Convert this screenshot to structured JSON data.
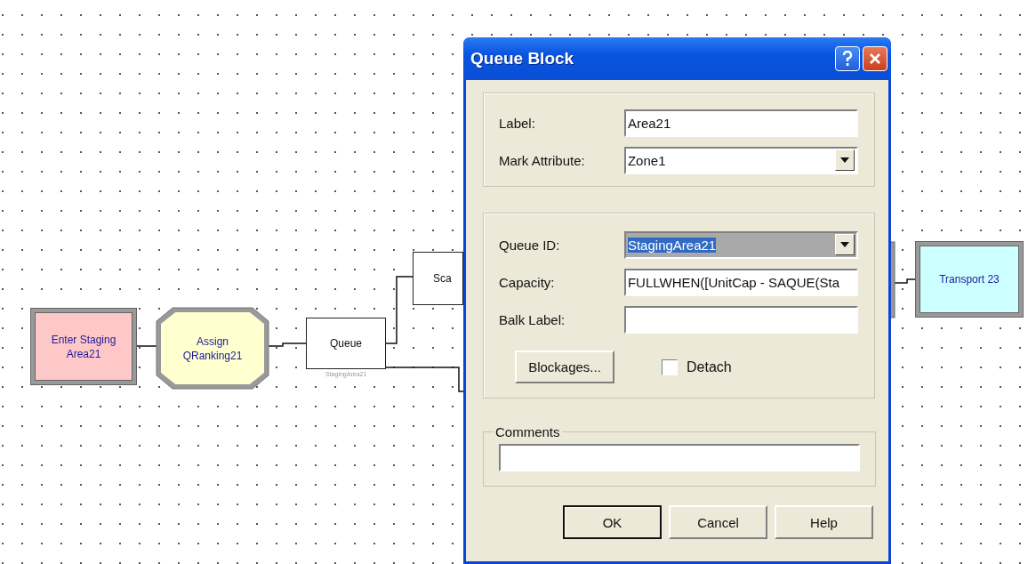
{
  "canvas": {
    "blocks": [
      {
        "kind": "enter",
        "label": "Enter Staging Area21",
        "color": "#ffc8c8"
      },
      {
        "kind": "assign",
        "label": "Assign QRanking21",
        "color": "#ffffd0"
      },
      {
        "kind": "queue",
        "label": "Queue",
        "caption": "StagingArea21",
        "color": "#ffffff"
      },
      {
        "kind": "plain",
        "label": "Sca",
        "color": "#ffffff"
      },
      {
        "kind": "transport",
        "label": "Transport 23",
        "color": "#ccffff"
      }
    ]
  },
  "dialog": {
    "title": "Queue Block",
    "groups": [
      {
        "fields": [
          {
            "label": "Label:",
            "kind": "text",
            "value": "Area21"
          },
          {
            "label": "Mark Attribute:",
            "kind": "combo",
            "value": "Zone1",
            "highlighted": false
          }
        ]
      },
      {
        "fields": [
          {
            "label": "Queue ID:",
            "kind": "combo",
            "value": "StagingArea21",
            "highlighted": true
          },
          {
            "label": "Capacity:",
            "kind": "text",
            "value": "FULLWHEN([UnitCap - SAQUE(Sta"
          },
          {
            "label": "Balk Label:",
            "kind": "text"
          }
        ],
        "button": "Blockages...",
        "checkbox": {
          "label": "Detach",
          "checked": false
        }
      }
    ],
    "comments": {
      "legend": "Comments"
    },
    "buttons": [
      {
        "label": "OK",
        "default": true
      },
      {
        "label": "Cancel",
        "default": false
      },
      {
        "label": "Help",
        "default": false
      }
    ]
  }
}
